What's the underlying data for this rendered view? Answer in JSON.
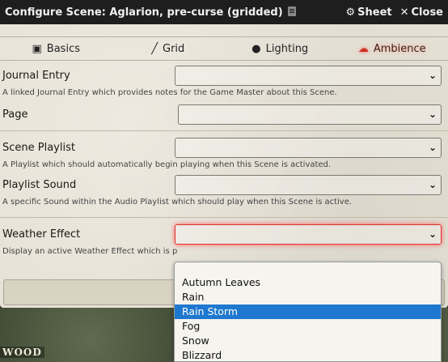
{
  "window": {
    "title": "Configure Scene: Aglarion, pre-curse (gridded)",
    "sheet_label": "Sheet",
    "close_label": "Close"
  },
  "tabs": [
    {
      "label": "Basics",
      "icon": "image-icon",
      "active": false
    },
    {
      "label": "Grid",
      "icon": "ruler-icon",
      "active": false
    },
    {
      "label": "Lighting",
      "icon": "lightbulb-icon",
      "active": false
    },
    {
      "label": "Ambience",
      "icon": "cloud-sun-icon",
      "active": true
    }
  ],
  "fields": {
    "journal_label": "Journal Entry",
    "journal_hint": "A linked Journal Entry which provides notes for the Game Master about this Scene.",
    "page_label": "Page",
    "playlist_label": "Scene Playlist",
    "playlist_hint": "A Playlist which should automatically begin playing when this Scene is activated.",
    "sound_label": "Playlist Sound",
    "sound_hint": "A specific Sound within the Audio Playlist which should play when this Scene is active.",
    "weather_label": "Weather Effect",
    "weather_hint": "Display an active Weather Effect which is p"
  },
  "weather_options": [
    "Autumn Leaves",
    "Rain",
    "Rain Storm",
    "Fog",
    "Snow",
    "Blizzard"
  ],
  "weather_highlighted": "Rain Storm",
  "map_label": "WOOD",
  "colors": {
    "accent": "#cc3322",
    "highlight": "#1e78cf",
    "titlebar": "#1e1e1e"
  }
}
